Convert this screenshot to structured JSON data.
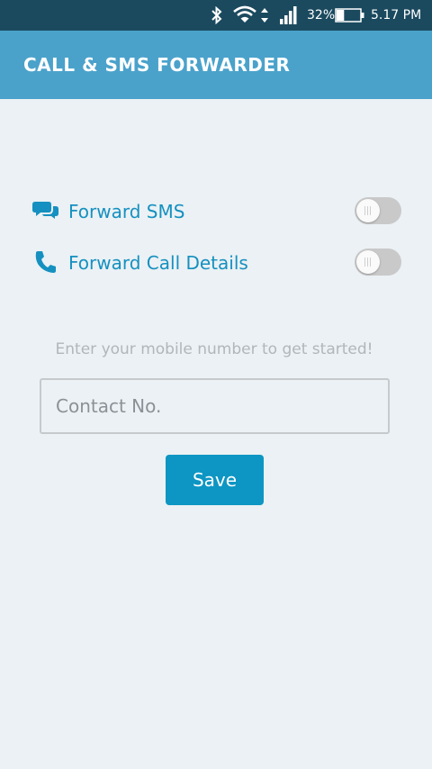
{
  "status_bar": {
    "battery_percent": "32%",
    "battery_level": 0.32,
    "time": "5.17 PM",
    "icons": [
      "bluetooth-icon",
      "wifi-icon",
      "signal-icon",
      "battery-icon"
    ]
  },
  "app_bar": {
    "title": "CALL & SMS FORWARDER",
    "color": "#4aa2cb"
  },
  "options": [
    {
      "label": "Forward SMS",
      "icon": "chat-bubbles-icon",
      "enabled": false
    },
    {
      "label": "Forward Call Details",
      "icon": "phone-icon",
      "enabled": false
    }
  ],
  "form": {
    "hint": "Enter your mobile number to get started!",
    "contact_placeholder": "Contact No.",
    "contact_value": "",
    "save_label": "Save"
  },
  "colors": {
    "accent": "#1590c0",
    "button": "#0d96c3",
    "background": "#ebf1f4",
    "status_bar": "#1b4a5f"
  }
}
